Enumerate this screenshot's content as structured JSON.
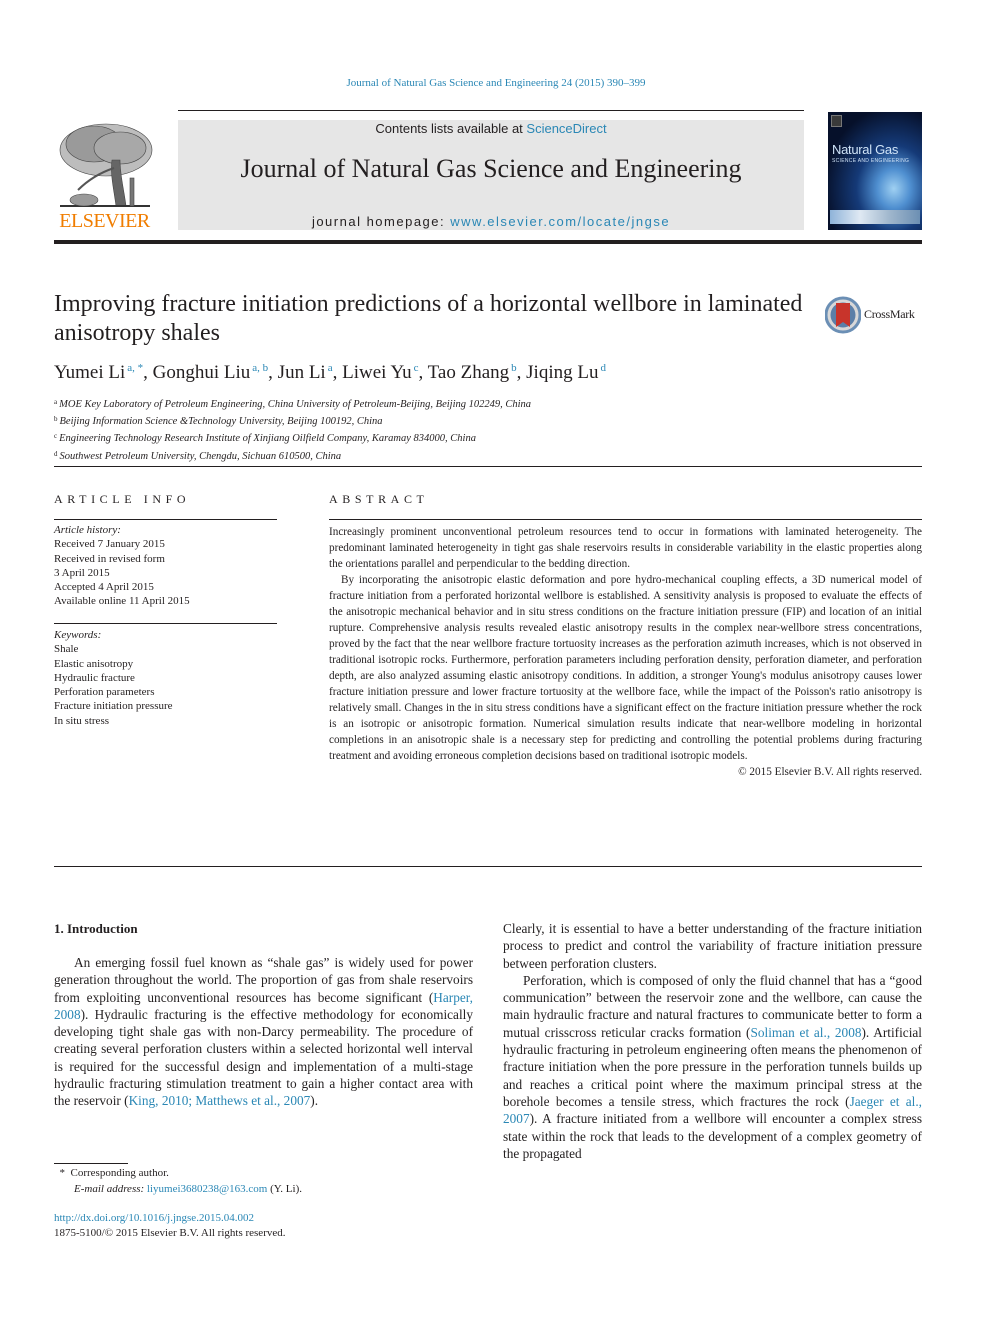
{
  "journal_reference": "Journal of Natural Gas Science and Engineering 24 (2015) 390–399",
  "masthead": {
    "publisher": "ELSEVIER",
    "contents_prefix": "Contents lists available at ",
    "contents_link": "ScienceDirect",
    "journal_title": "Journal of Natural Gas Science and Engineering",
    "homepage_prefix": "journal homepage: ",
    "homepage_link": "www.elsevier.com/locate/jngse",
    "cover_title": "Natural Gas",
    "cover_subtitle": "SCIENCE AND ENGINEERING"
  },
  "article": {
    "title": "Improving fracture initiation predictions of a horizontal wellbore in laminated anisotropy shales",
    "crossmark_label": "CrossMark",
    "authors": [
      {
        "name": "Yumei Li",
        "sup": "a, *",
        "sep": ", "
      },
      {
        "name": "Gonghui Liu",
        "sup": "a, b",
        "sep": ", "
      },
      {
        "name": "Jun Li",
        "sup": "a",
        "sep": ", "
      },
      {
        "name": "Liwei Yu",
        "sup": "c",
        "sep": ", "
      },
      {
        "name": "Tao Zhang",
        "sup": "b",
        "sep": ", "
      },
      {
        "name": "Jiqing Lu",
        "sup": "d",
        "sep": ""
      }
    ],
    "affiliations": [
      {
        "key": "a",
        "text": "MOE Key Laboratory of Petroleum Engineering, China University of Petroleum-Beijing, Beijing 102249, China"
      },
      {
        "key": "b",
        "text": "Beijing Information Science &Technology University, Beijing 100192, China"
      },
      {
        "key": "c",
        "text": "Engineering Technology Research Institute of Xinjiang Oilfield Company, Karamay 834000, China"
      },
      {
        "key": "d",
        "text": "Southwest Petroleum University, Chengdu, Sichuan 610500, China"
      }
    ]
  },
  "article_info": {
    "heading": "ARTICLE INFO",
    "history_label": "Article history:",
    "history": [
      "Received 7 January 2015",
      "Received in revised form",
      "3 April 2015",
      "Accepted 4 April 2015",
      "Available online 11 April 2015"
    ],
    "keywords_label": "Keywords:",
    "keywords": [
      "Shale",
      "Elastic anisotropy",
      "Hydraulic fracture",
      "Perforation parameters",
      "Fracture initiation pressure",
      "In situ stress"
    ]
  },
  "abstract": {
    "heading": "ABSTRACT",
    "paragraphs": [
      "Increasingly prominent unconventional petroleum resources tend to occur in formations with laminated heterogeneity. The predominant laminated heterogeneity in tight gas shale reservoirs results in considerable variability in the elastic properties along the orientations parallel and perpendicular to the bedding direction.",
      "By incorporating the anisotropic elastic deformation and pore hydro-mechanical coupling effects, a 3D numerical model of fracture initiation from a perforated horizontal wellbore is established. A sensitivity analysis is proposed to evaluate the effects of the anisotropic mechanical behavior and in situ stress conditions on the fracture initiation pressure (FIP) and location of an initial rupture. Comprehensive analysis results revealed elastic anisotropy results in the complex near-wellbore stress concentrations, proved by the fact that the near wellbore fracture tortuosity increases as the perforation azimuth increases, which is not observed in traditional isotropic rocks. Furthermore, perforation parameters including perforation density, perforation diameter, and perforation depth, are also analyzed assuming elastic anisotropy conditions. In addition, a stronger Young's modulus anisotropy causes lower fracture initiation pressure and lower fracture tortuosity at the wellbore face, while the impact of the Poisson's ratio anisotropy is relatively small. Changes in the in situ stress conditions have a significant effect on the fracture initiation pressure whether the rock is an isotropic or anisotropic formation. Numerical simulation results indicate that near-wellbore modeling in horizontal completions in an anisotropic shale is a necessary step for predicting and controlling the potential problems during fracturing treatment and avoiding erroneous completion decisions based on traditional isotropic models."
    ],
    "copyright": "© 2015 Elsevier B.V. All rights reserved."
  },
  "introduction": {
    "heading": "1.  Introduction",
    "left_paragraph": [
      {
        "text": "An emerging fossil fuel known as “shale gas” is widely used for power generation throughout the world. The proportion of gas from shale reservoirs from exploiting unconventional resources has become significant ("
      },
      {
        "link": "Harper, 2008"
      },
      {
        "text": "). Hydraulic fracturing is the effective methodology for economically developing tight shale gas with non-Darcy permeability. The procedure of creating several perforation clusters within a selected horizontal well interval is required for the successful design and implementation of a multi-stage hydraulic fracturing stimulation treatment to gain a higher contact area with the reservoir ("
      },
      {
        "link": "King, 2010; Matthews et al., 2007"
      },
      {
        "text": ")."
      }
    ],
    "right_paragraph_1": "Clearly, it is essential to have a better understanding of the fracture initiation process to predict and control the variability of fracture initiation pressure between perforation clusters.",
    "right_paragraph_2": [
      {
        "text": "Perforation, which is composed of only the fluid channel that has a “good communication” between the reservoir zone and the wellbore, can cause the main hydraulic fracture and natural fractures to communicate better to form a mutual crisscross reticular cracks formation ("
      },
      {
        "link": "Soliman et al., 2008"
      },
      {
        "text": "). Artificial hydraulic fracturing in petroleum engineering often means the phenomenon of fracture initiation when the pore pressure in the perforation tunnels builds up and reaches a critical point where the maximum principal stress at the borehole becomes a tensile stress, which fractures the rock ("
      },
      {
        "link": "Jaeger et al., 2007"
      },
      {
        "text": "). A fracture initiated from a wellbore will encounter a complex stress state within the rock that leads to the development of a complex geometry of the propagated"
      }
    ]
  },
  "footnotes": {
    "corresponding_mark": "*",
    "corresponding_text": "Corresponding author.",
    "email_label": "E-mail address:",
    "email": "liyumei3680238@163.com",
    "email_suffix": " (Y. Li).",
    "doi": "http://dx.doi.org/10.1016/j.jngse.2015.04.002",
    "issn_line": "1875-5100/© 2015 Elsevier B.V. All rights reserved."
  },
  "colors": {
    "link": "#2a87b5",
    "elsevier_orange": "#f07d00",
    "masthead_bg": "#e6e6e6",
    "text": "#231f20"
  }
}
